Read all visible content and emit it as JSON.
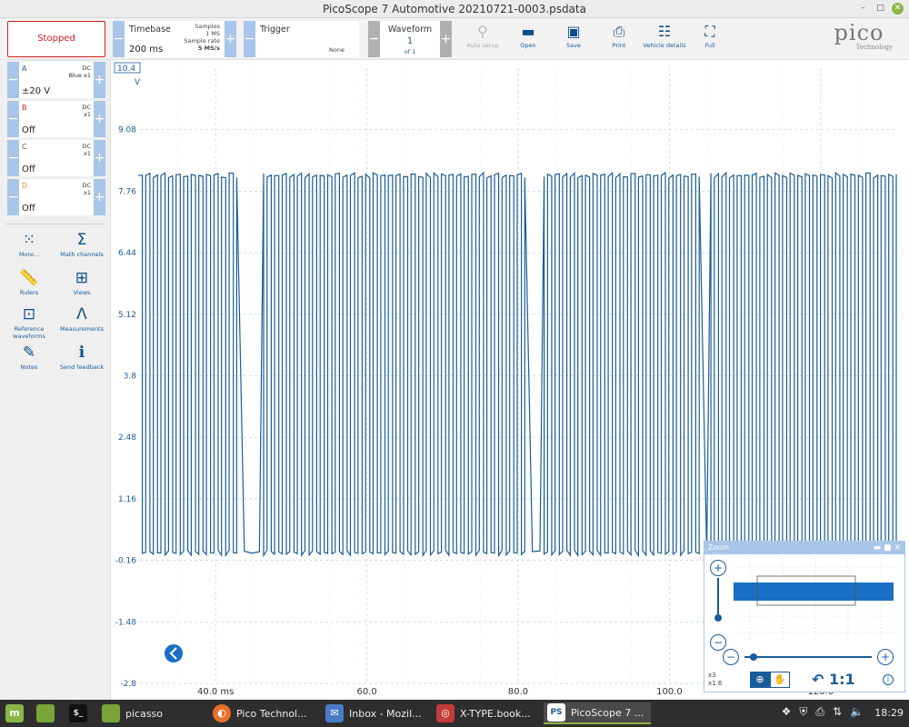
{
  "window": {
    "title": "PicoScope 7 Automotive 20210721-0003.psdata"
  },
  "toolbar": {
    "run_state": "Stopped",
    "timebase": {
      "label": "Timebase",
      "value": "200 ms",
      "samples_label": "Samples",
      "samples_value": "1 MS",
      "rate_label": "Sample rate",
      "rate_value": "5 MS/s"
    },
    "trigger": {
      "label": "Trigger",
      "mode": "None"
    },
    "waveform": {
      "label": "Waveform",
      "index": "1",
      "of": "of 1"
    },
    "tools": [
      {
        "label": "Auto setup",
        "icon": "wand-icon",
        "enabled": false
      },
      {
        "label": "Open",
        "icon": "folder-icon",
        "enabled": true
      },
      {
        "label": "Save",
        "icon": "floppy-icon",
        "enabled": true
      },
      {
        "label": "Print",
        "icon": "printer-icon",
        "enabled": true
      },
      {
        "label": "Vehicle details",
        "icon": "clipboard-icon",
        "enabled": true
      },
      {
        "label": "Full",
        "icon": "fullscreen-icon",
        "enabled": true
      }
    ],
    "logo": {
      "name": "pico",
      "sub": "Technology"
    }
  },
  "channels": [
    {
      "name": "A",
      "coupling": "DC",
      "probe": "Blue x1",
      "range": "±20 V",
      "color": "#1a5c99"
    },
    {
      "name": "B",
      "coupling": "DC",
      "probe": "x1",
      "range": "Off",
      "color": "#d42020"
    },
    {
      "name": "C",
      "coupling": "DC",
      "probe": "x1",
      "range": "Off",
      "color": "#555555"
    },
    {
      "name": "D",
      "coupling": "DC",
      "probe": "x1",
      "range": "Off",
      "color": "#d4a020"
    }
  ],
  "side_buttons": [
    {
      "label": "More...",
      "icon": "grid-dots-icon"
    },
    {
      "label": "Math channels",
      "icon": "sigma-icon"
    },
    {
      "label": "Rulers",
      "icon": "ruler-icon"
    },
    {
      "label": "Views",
      "icon": "views-grid-icon"
    },
    {
      "label": "Reference waveforms",
      "icon": "reference-waveform-icon"
    },
    {
      "label": "Measurements",
      "icon": "compass-icon"
    },
    {
      "label": "Notes",
      "icon": "notes-icon"
    },
    {
      "label": "Send feedback",
      "icon": "feedback-icon"
    }
  ],
  "chart_data": {
    "type": "line",
    "series": [
      {
        "values": "square-wave, low ≈ 0.0 V, high ≈ 8.1 V, ~100 pulses across visible window",
        "color": "#1a5c99"
      }
    ],
    "y_unit": "V",
    "y_ticks": [
      "10.4",
      "9.08",
      "7.76",
      "6.44",
      "5.12",
      "3.8",
      "2.48",
      "1.16",
      "-0.16",
      "-1.48",
      "-2.8"
    ],
    "ylim": [
      -2.8,
      10.4
    ],
    "x_ticks": [
      "40.0 ms",
      "60.0",
      "80.0",
      "100.0",
      "120.0"
    ],
    "x_tick_values": [
      40,
      60,
      80,
      100,
      120
    ],
    "xlim": [
      30,
      130
    ],
    "signal": {
      "low": 0.0,
      "high": 8.1,
      "pulses": 100
    },
    "grid": true
  },
  "zoom_panel": {
    "title": "Zoom",
    "scale_top": "x3",
    "scale_bottom": "x1.6",
    "reset_label": "1:1",
    "zoom_icon": "zoom-in-icon",
    "pan_icon": "hand-icon",
    "undo_icon": "undo-icon",
    "info_icon": "info-icon"
  },
  "taskbar": {
    "items": [
      {
        "label": "",
        "icon": "mint-menu-icon"
      },
      {
        "label": "",
        "icon": "files-icon"
      },
      {
        "label": "",
        "icon": "terminal-icon"
      },
      {
        "label": "picasso",
        "icon": "folder-icon"
      },
      {
        "label": "Pico Technol...",
        "icon": "firefox-icon"
      },
      {
        "label": "Inbox - Mozil...",
        "icon": "thunderbird-icon"
      },
      {
        "label": "X-TYPE.book...",
        "icon": "reader-icon"
      },
      {
        "label": "PicoScope 7 ...",
        "icon": "picoscope-icon"
      }
    ],
    "clock": "18:29"
  }
}
